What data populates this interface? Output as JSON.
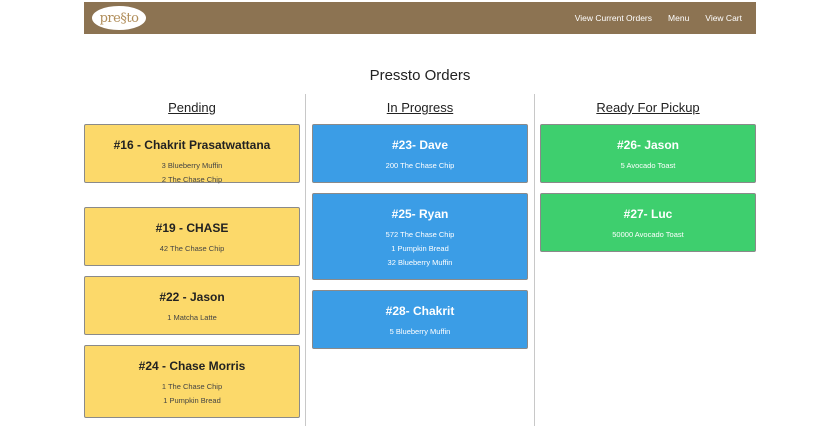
{
  "nav": {
    "logo_text": "pre§to",
    "links": [
      "View Current Orders",
      "Menu",
      "View Cart"
    ]
  },
  "title": "Pressto Orders",
  "columns": [
    {
      "title": "Pending",
      "orders": [
        {
          "title": "#16 - Chakrit Prasatwattana",
          "items": [
            "3 Blueberry Muffin",
            "2 The Chase Chip"
          ]
        },
        {
          "title": "#19 - CHASE",
          "items": [
            "42 The Chase Chip"
          ]
        },
        {
          "title": "#22 - Jason",
          "items": [
            "1 Matcha Latte"
          ]
        },
        {
          "title": "#24 - Chase Morris",
          "items": [
            "1 The Chase Chip",
            "1 Pumpkin Bread"
          ]
        }
      ]
    },
    {
      "title": "In Progress",
      "orders": [
        {
          "title": "#23- Dave",
          "items": [
            "200 The Chase Chip"
          ]
        },
        {
          "title": "#25- Ryan",
          "items": [
            "572 The Chase Chip",
            "1 Pumpkin Bread",
            "32 Blueberry Muffin"
          ]
        },
        {
          "title": "#28- Chakrit",
          "items": [
            "5 Blueberry Muffin"
          ]
        }
      ]
    },
    {
      "title": "Ready For Pickup",
      "orders": [
        {
          "title": "#26- Jason",
          "items": [
            "5 Avocado Toast"
          ]
        },
        {
          "title": "#27- Luc",
          "items": [
            "50000 Avocado Toast"
          ]
        }
      ]
    }
  ]
}
